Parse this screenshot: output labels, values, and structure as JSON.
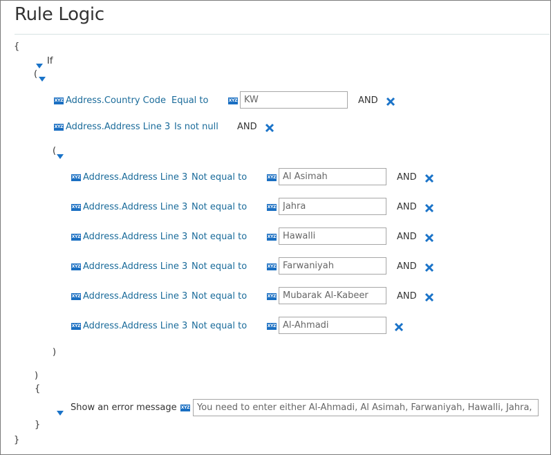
{
  "title": "Rule Logic",
  "braces": {
    "open": "{",
    "close": "}"
  },
  "parens": {
    "open": "(",
    "close": ")"
  },
  "if_label": "If",
  "icon_text": "XYZ",
  "conditions": [
    {
      "field": "Address.Country Code",
      "operator": "Equal to",
      "value": "KW",
      "connector": "AND"
    },
    {
      "field": "Address.Address Line 3",
      "operator": "Is not null",
      "connector": "AND"
    }
  ],
  "group_conditions": [
    {
      "field": "Address.Address Line 3",
      "operator": "Not equal to",
      "value": "Al Asimah",
      "connector": "AND"
    },
    {
      "field": "Address.Address Line 3",
      "operator": "Not equal to",
      "value": "Jahra",
      "connector": "AND"
    },
    {
      "field": "Address.Address Line 3",
      "operator": "Not equal to",
      "value": "Hawalli",
      "connector": "AND"
    },
    {
      "field": "Address.Address Line 3",
      "operator": "Not equal to",
      "value": "Farwaniyah",
      "connector": "AND"
    },
    {
      "field": "Address.Address Line 3",
      "operator": "Not equal to",
      "value": "Mubarak Al-Kabeer",
      "connector": "AND"
    },
    {
      "field": "Address.Address Line 3",
      "operator": "Not equal to",
      "value": "Al-Ahmadi"
    }
  ],
  "action": {
    "label": "Show an error message",
    "value": "You need to enter either Al-Ahmadi, Al Asimah, Farwaniyah, Hawalli, Jahra, or M"
  },
  "colors": {
    "accent": "#1a73c8",
    "field_text": "#1a6b9a",
    "divider": "#d6e2e2"
  }
}
